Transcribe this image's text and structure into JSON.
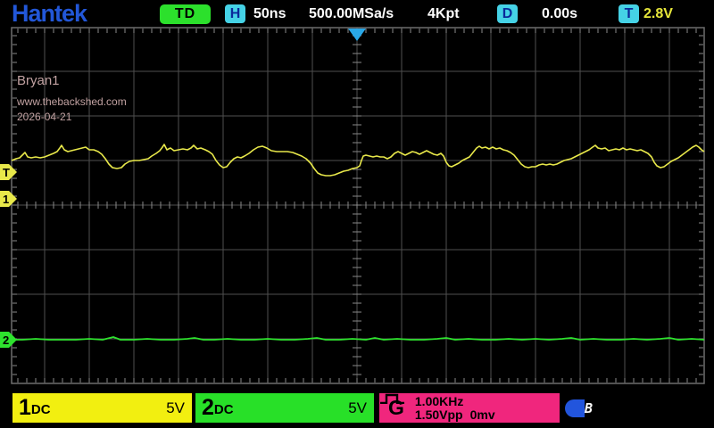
{
  "header": {
    "logo": "Hantek",
    "trigger_status": "TD",
    "horizontal_icon_label": "H",
    "timebase": "50ns",
    "sample_rate": "500.00MSa/s",
    "record_length": "4Kpt",
    "delay_icon_label": "D",
    "horizontal_offset": "0.00s",
    "trigger_icon_label": "T",
    "trigger_level": "2.8V"
  },
  "screen_overlay": {
    "line1": "Bryan1",
    "line2": "www.thebackshed.com",
    "line3": "2026-04-21"
  },
  "markers": {
    "trigger_level_label": "T",
    "ch1_zero_label": "1",
    "ch2_zero_label": "2"
  },
  "footer": {
    "ch1": {
      "number": "1",
      "coupling": "DC",
      "scale": "5V"
    },
    "ch2": {
      "number": "2",
      "coupling": "DC",
      "scale": "5V"
    },
    "generator": {
      "label": "G",
      "frequency": "1.00KHz",
      "amplitude": "1.50Vpp",
      "offset": "0mv"
    },
    "usb_label": "B"
  },
  "colors": {
    "ch1_yellow": "#e8e84a",
    "ch2_green": "#2ee22e",
    "generator_pink": "#f0267d",
    "status_cyan": "#45d2e6",
    "logo_blue": "#2257d8",
    "trigger_marker_blue": "#29a8e8",
    "grid_gray": "#4f4f4f"
  },
  "chart_data": {
    "type": "line",
    "title": "Oscilloscope traces (screen pixel coordinates, 50 px per division, 8x16 div grid)",
    "x_unit": "50ns/div",
    "series": [
      {
        "name": "CH1",
        "volts_per_div": "5V",
        "color": "#e8e84a",
        "points": [
          [
            13,
            180
          ],
          [
            18,
            178
          ],
          [
            22,
            177
          ],
          [
            26,
            173
          ],
          [
            28,
            171
          ],
          [
            31,
            176
          ],
          [
            35,
            177
          ],
          [
            40,
            176
          ],
          [
            45,
            177
          ],
          [
            50,
            176
          ],
          [
            55,
            174
          ],
          [
            60,
            172
          ],
          [
            64,
            170
          ],
          [
            67,
            166
          ],
          [
            69,
            163
          ],
          [
            72,
            168
          ],
          [
            76,
            170
          ],
          [
            80,
            169
          ],
          [
            84,
            168
          ],
          [
            88,
            167
          ],
          [
            92,
            166
          ],
          [
            96,
            165
          ],
          [
            100,
            168
          ],
          [
            105,
            168
          ],
          [
            110,
            170
          ],
          [
            114,
            173
          ],
          [
            118,
            178
          ],
          [
            122,
            184
          ],
          [
            126,
            188
          ],
          [
            131,
            189
          ],
          [
            136,
            188
          ],
          [
            140,
            184
          ],
          [
            145,
            181
          ],
          [
            150,
            180
          ],
          [
            156,
            180
          ],
          [
            161,
            179
          ],
          [
            166,
            178
          ],
          [
            170,
            175
          ],
          [
            175,
            172
          ],
          [
            179,
            169
          ],
          [
            182,
            165
          ],
          [
            184,
            162
          ],
          [
            187,
            168
          ],
          [
            191,
            166
          ],
          [
            195,
            169
          ],
          [
            200,
            168
          ],
          [
            205,
            167
          ],
          [
            210,
            168
          ],
          [
            214,
            166
          ],
          [
            217,
            163
          ],
          [
            221,
            167
          ],
          [
            225,
            166
          ],
          [
            230,
            168
          ],
          [
            234,
            170
          ],
          [
            238,
            173
          ],
          [
            242,
            180
          ],
          [
            246,
            185
          ],
          [
            250,
            188
          ],
          [
            254,
            187
          ],
          [
            258,
            182
          ],
          [
            262,
            178
          ],
          [
            266,
            176
          ],
          [
            270,
            177
          ],
          [
            274,
            175
          ],
          [
            279,
            172
          ],
          [
            284,
            168
          ],
          [
            289,
            165
          ],
          [
            294,
            164
          ],
          [
            299,
            166
          ],
          [
            304,
            169
          ],
          [
            310,
            170
          ],
          [
            316,
            170
          ],
          [
            322,
            170
          ],
          [
            328,
            171
          ],
          [
            333,
            173
          ],
          [
            338,
            175
          ],
          [
            343,
            178
          ],
          [
            348,
            183
          ],
          [
            352,
            189
          ],
          [
            356,
            194
          ],
          [
            360,
            196
          ],
          [
            365,
            197
          ],
          [
            370,
            197
          ],
          [
            375,
            196
          ],
          [
            380,
            194
          ],
          [
            385,
            192
          ],
          [
            390,
            191
          ],
          [
            395,
            189
          ],
          [
            400,
            188
          ],
          [
            403,
            186
          ],
          [
            405,
            180
          ],
          [
            407,
            175
          ],
          [
            410,
            174
          ],
          [
            414,
            175
          ],
          [
            418,
            176
          ],
          [
            422,
            175
          ],
          [
            426,
            176
          ],
          [
            430,
            176
          ],
          [
            434,
            178
          ],
          [
            438,
            176
          ],
          [
            442,
            172
          ],
          [
            446,
            170
          ],
          [
            450,
            172
          ],
          [
            454,
            174
          ],
          [
            458,
            172
          ],
          [
            462,
            170
          ],
          [
            466,
            171
          ],
          [
            470,
            173
          ],
          [
            474,
            171
          ],
          [
            478,
            169
          ],
          [
            482,
            171
          ],
          [
            486,
            173
          ],
          [
            490,
            174
          ],
          [
            494,
            172
          ],
          [
            497,
            175
          ],
          [
            500,
            182
          ],
          [
            503,
            186
          ],
          [
            506,
            187
          ],
          [
            510,
            185
          ],
          [
            514,
            183
          ],
          [
            518,
            180
          ],
          [
            522,
            178
          ],
          [
            526,
            176
          ],
          [
            530,
            171
          ],
          [
            534,
            166
          ],
          [
            537,
            164
          ],
          [
            540,
            166
          ],
          [
            544,
            165
          ],
          [
            548,
            167
          ],
          [
            552,
            165
          ],
          [
            556,
            167
          ],
          [
            560,
            166
          ],
          [
            564,
            168
          ],
          [
            568,
            169
          ],
          [
            572,
            171
          ],
          [
            576,
            174
          ],
          [
            580,
            179
          ],
          [
            584,
            184
          ],
          [
            588,
            187
          ],
          [
            592,
            188
          ],
          [
            596,
            187
          ],
          [
            600,
            187
          ],
          [
            604,
            185
          ],
          [
            608,
            184
          ],
          [
            612,
            185
          ],
          [
            616,
            184
          ],
          [
            620,
            185
          ],
          [
            624,
            184
          ],
          [
            628,
            182
          ],
          [
            632,
            180
          ],
          [
            636,
            179
          ],
          [
            640,
            178
          ],
          [
            644,
            176
          ],
          [
            648,
            174
          ],
          [
            652,
            172
          ],
          [
            656,
            170
          ],
          [
            660,
            168
          ],
          [
            664,
            165
          ],
          [
            667,
            163
          ],
          [
            670,
            166
          ],
          [
            674,
            167
          ],
          [
            678,
            166
          ],
          [
            682,
            169
          ],
          [
            686,
            168
          ],
          [
            690,
            167
          ],
          [
            694,
            168
          ],
          [
            698,
            166
          ],
          [
            702,
            168
          ],
          [
            706,
            167
          ],
          [
            710,
            168
          ],
          [
            714,
            169
          ],
          [
            718,
            168
          ],
          [
            722,
            170
          ],
          [
            726,
            172
          ],
          [
            730,
            176
          ],
          [
            733,
            182
          ],
          [
            736,
            186
          ],
          [
            740,
            188
          ],
          [
            744,
            187
          ],
          [
            748,
            184
          ],
          [
            752,
            181
          ],
          [
            756,
            179
          ],
          [
            760,
            177
          ],
          [
            764,
            174
          ],
          [
            768,
            171
          ],
          [
            772,
            168
          ],
          [
            776,
            165
          ],
          [
            780,
            163
          ],
          [
            783,
            165
          ],
          [
            786,
            168
          ],
          [
            789,
            170
          ]
        ]
      },
      {
        "name": "CH2",
        "volts_per_div": "5V",
        "color": "#2ee22e",
        "points": [
          [
            13,
            381
          ],
          [
            25,
            381
          ],
          [
            40,
            380
          ],
          [
            55,
            381
          ],
          [
            70,
            381
          ],
          [
            85,
            381
          ],
          [
            100,
            380
          ],
          [
            115,
            381
          ],
          [
            127,
            378
          ],
          [
            135,
            381
          ],
          [
            150,
            381
          ],
          [
            165,
            380
          ],
          [
            180,
            381
          ],
          [
            195,
            381
          ],
          [
            210,
            380
          ],
          [
            218,
            379
          ],
          [
            228,
            381
          ],
          [
            240,
            381
          ],
          [
            255,
            380
          ],
          [
            270,
            381
          ],
          [
            285,
            381
          ],
          [
            300,
            380
          ],
          [
            315,
            381
          ],
          [
            330,
            381
          ],
          [
            345,
            380
          ],
          [
            355,
            379
          ],
          [
            365,
            381
          ],
          [
            380,
            381
          ],
          [
            395,
            380
          ],
          [
            410,
            381
          ],
          [
            420,
            379
          ],
          [
            430,
            381
          ],
          [
            445,
            380
          ],
          [
            460,
            381
          ],
          [
            475,
            381
          ],
          [
            490,
            380
          ],
          [
            500,
            379
          ],
          [
            510,
            381
          ],
          [
            525,
            380
          ],
          [
            540,
            381
          ],
          [
            555,
            381
          ],
          [
            570,
            380
          ],
          [
            585,
            381
          ],
          [
            600,
            380
          ],
          [
            615,
            381
          ],
          [
            630,
            380
          ],
          [
            640,
            379
          ],
          [
            650,
            381
          ],
          [
            665,
            380
          ],
          [
            680,
            381
          ],
          [
            695,
            381
          ],
          [
            710,
            380
          ],
          [
            725,
            381
          ],
          [
            740,
            380
          ],
          [
            750,
            379
          ],
          [
            760,
            381
          ],
          [
            775,
            380
          ],
          [
            789,
            381
          ]
        ]
      }
    ]
  }
}
